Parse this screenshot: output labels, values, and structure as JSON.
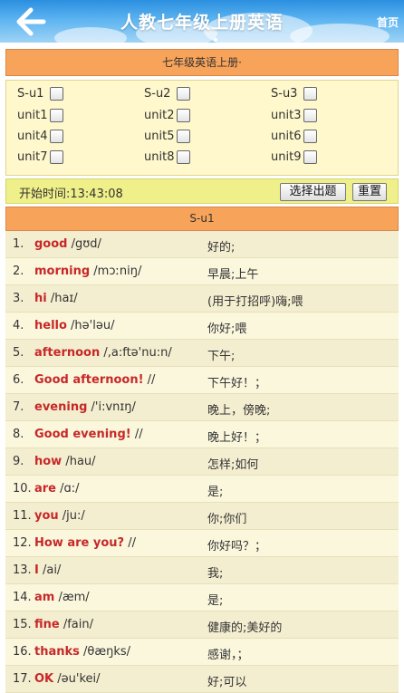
{
  "header": {
    "title": "人教七年级上册英语",
    "home_label": "首页",
    "back_icon": "back-arrow-icon"
  },
  "book_section": {
    "title": "七年级英语上册·"
  },
  "units": [
    {
      "label": "S-u1",
      "checked": false
    },
    {
      "label": "S-u2",
      "checked": false
    },
    {
      "label": "S-u3",
      "checked": false
    },
    {
      "label": "unit1",
      "checked": false
    },
    {
      "label": "unit2",
      "checked": false
    },
    {
      "label": "unit3",
      "checked": false
    },
    {
      "label": "unit4",
      "checked": false
    },
    {
      "label": "unit5",
      "checked": false
    },
    {
      "label": "unit6",
      "checked": false
    },
    {
      "label": "unit7",
      "checked": false
    },
    {
      "label": "unit8",
      "checked": false
    },
    {
      "label": "unit9",
      "checked": false
    }
  ],
  "toolbar": {
    "start_time": "开始时间:13:43:08",
    "select_button": "选择出题",
    "reset_button": "重置"
  },
  "list_section": {
    "title": "S-u1"
  },
  "words": [
    {
      "num": "1.",
      "word": "good",
      "phonetic": " /gʊd/",
      "meaning": "好的;"
    },
    {
      "num": "2.",
      "word": "morning",
      "phonetic": " /mɔːniŋ/",
      "meaning": "早晨;上午"
    },
    {
      "num": "3.",
      "word": "hi",
      "phonetic": " /haɪ/",
      "meaning": "(用于打招呼)嗨;喂"
    },
    {
      "num": "4.",
      "word": "hello",
      "phonetic": " /hə'ləu/",
      "meaning": "你好;喂"
    },
    {
      "num": "5.",
      "word": "afternoon",
      "phonetic": " /,a:ftə'nu:n/",
      "meaning": "下午;"
    },
    {
      "num": "6.",
      "word": "Good afternoon!",
      "phonetic": " //",
      "meaning": "下午好！；"
    },
    {
      "num": "7.",
      "word": "evening",
      "phonetic": " /'i:vnɪŋ/",
      "meaning": "晚上，傍晚;"
    },
    {
      "num": "8.",
      "word": "Good evening!",
      "phonetic": " //",
      "meaning": "晚上好！；"
    },
    {
      "num": "9.",
      "word": "how",
      "phonetic": " /hau/",
      "meaning": "怎样;如何"
    },
    {
      "num": "10.",
      "word": "are",
      "phonetic": " /ɑ:/",
      "meaning": "是;"
    },
    {
      "num": "11.",
      "word": "you",
      "phonetic": " /ju:/",
      "meaning": "你;你们"
    },
    {
      "num": "12.",
      "word": "How are you?",
      "phonetic": " //",
      "meaning": "你好吗？；"
    },
    {
      "num": "13.",
      "word": "I",
      "phonetic": " /ai/",
      "meaning": "我;"
    },
    {
      "num": "14.",
      "word": "am",
      "phonetic": " /æm/",
      "meaning": "是;"
    },
    {
      "num": "15.",
      "word": "fine",
      "phonetic": " /fain/",
      "meaning": "健康的;美好的"
    },
    {
      "num": "16.",
      "word": "thanks",
      "phonetic": " /θæŋks/",
      "meaning": "感谢，；"
    },
    {
      "num": "17.",
      "word": "OK",
      "phonetic": " /əu'kei/",
      "meaning": "好;可以"
    }
  ]
}
